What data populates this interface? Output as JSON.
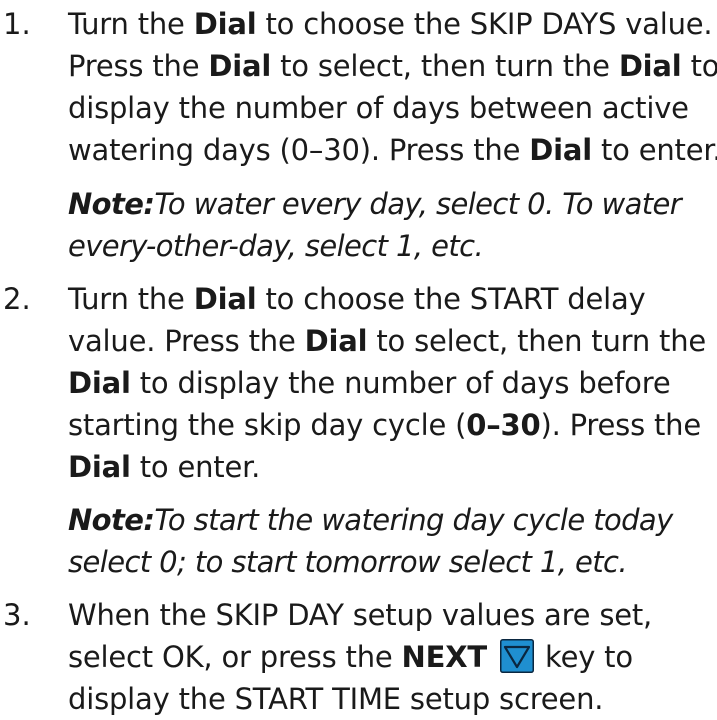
{
  "steps": [
    {
      "number": "1.",
      "lines": [
        [
          "Turn the ",
          {
            "b": "Dial"
          },
          " to choose the SKIP DAYS value."
        ],
        [
          "Press the ",
          {
            "b": "Dial"
          },
          " to select, then turn the ",
          {
            "b": "Dial"
          },
          " to"
        ],
        [
          "display the number of days between active"
        ],
        [
          "watering days (0–30). Press the ",
          {
            "b": "Dial"
          },
          " to enter."
        ]
      ],
      "note": {
        "label": "Note:",
        "lines": [
          "To water every day, select 0. To water",
          "every-other-day, select 1, etc."
        ]
      }
    },
    {
      "number": "2.",
      "lines": [
        [
          "Turn the ",
          {
            "b": "Dial"
          },
          "  to choose the START delay"
        ],
        [
          "value. Press the ",
          {
            "b": "Dial"
          },
          " to select, then turn the"
        ],
        [
          {
            "b": "Dial"
          },
          " to display the number of days before"
        ],
        [
          "starting the skip day cycle (",
          {
            "b": "0–30"
          },
          "). Press the"
        ],
        [
          {
            "b": "Dial"
          },
          " to enter."
        ]
      ],
      "note": {
        "label": "Note:",
        "lines": [
          "To start the watering day cycle today",
          "select 0; to start tomorrow select 1, etc."
        ]
      }
    },
    {
      "number": "3.",
      "lines": [
        [
          "When the SKIP DAY setup values are set,"
        ],
        [
          "select OK, or press the ",
          {
            "b": "NEXT"
          },
          " ",
          {
            "icon": "next-key-icon"
          },
          " key to"
        ],
        [
          "display the START TIME setup screen."
        ]
      ]
    }
  ],
  "colors": {
    "text": "#1a1a1a",
    "next_key_fill": "#1f8fd0",
    "next_key_border": "#0a2740"
  }
}
